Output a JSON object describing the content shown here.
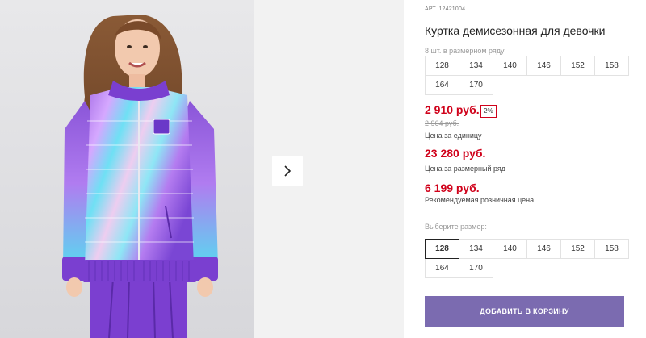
{
  "product": {
    "article_label": "АРТ.",
    "article": "12421004",
    "title": "Куртка демисезонная для девочки",
    "size_row_note": "8 шт. в размерном ряду",
    "size_row": [
      "128",
      "134",
      "140",
      "146",
      "152",
      "158",
      "164",
      "170"
    ]
  },
  "pricing": {
    "unit_price": "2 910 руб.",
    "discount": "2%",
    "old_price": "2 964 руб.",
    "unit_caption": "Цена за единицу",
    "set_price": "23 280 руб.",
    "set_caption": "Цена за размерный ряд",
    "retail_price": "6 199 руб.",
    "retail_caption": "Рекомендуемая розничная цена"
  },
  "size_picker": {
    "label": "Выберите размер:",
    "options": [
      "128",
      "134",
      "140",
      "146",
      "152",
      "158",
      "164",
      "170"
    ],
    "selected": "128"
  },
  "actions": {
    "add_to_cart": "Добавить в корзину"
  },
  "colors": {
    "price_red": "#d0021b",
    "cart_button": "#7b6bb0",
    "jacket_purple": "#8a55d8",
    "jacket_cyan": "#5ad8f0"
  },
  "icons": {
    "next": "chevron-right-icon"
  }
}
